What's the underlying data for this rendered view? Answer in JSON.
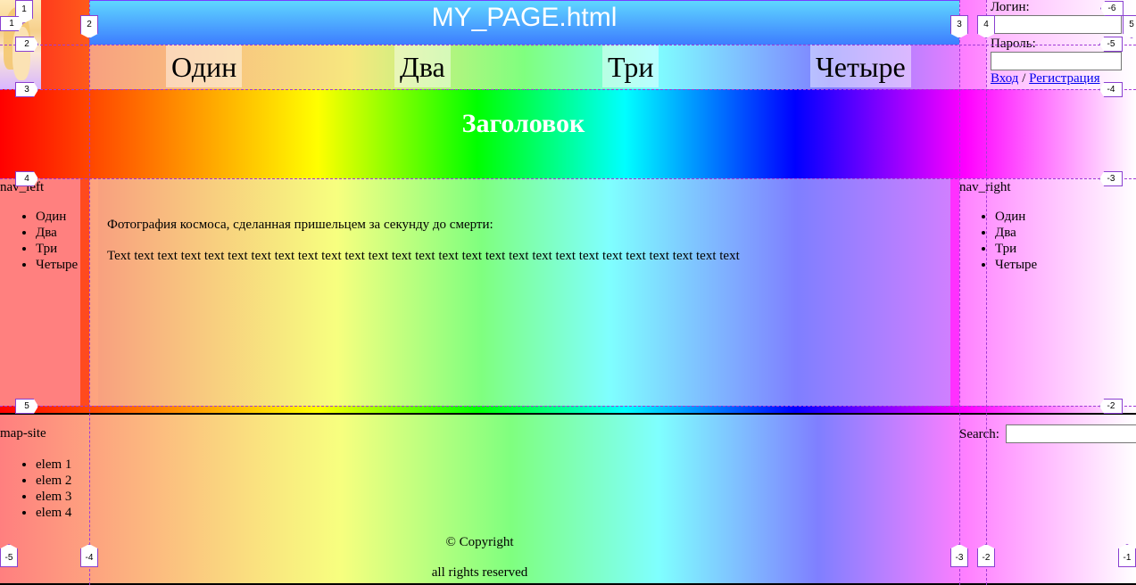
{
  "window": {
    "title": "MY_PAGE.html"
  },
  "nav": {
    "items": [
      "Один",
      "Два",
      "Три",
      "Четыре"
    ]
  },
  "login": {
    "login_label": "Логин:",
    "password_label": "Пароль:",
    "login_value": "",
    "password_value": "",
    "signin_link": "Вход",
    "separator": "/",
    "register_link": "Регистрация"
  },
  "header": {
    "title": "Заголовок"
  },
  "nav_left": {
    "title": "nav_left",
    "items": [
      "Один",
      "Два",
      "Три",
      "Четыре"
    ]
  },
  "nav_right": {
    "title": "nav_right",
    "items": [
      "Один",
      "Два",
      "Три",
      "Четыре"
    ]
  },
  "content": {
    "caption": "Фотография космоса, сделанная пришельцем за секунду до смерти:",
    "text": "Text text text text text text text text text text text text text text text text text text text text text text text text text text text"
  },
  "footer": {
    "map_title": "map-site",
    "map_items": [
      "elem 1",
      "elem 2",
      "elem 3",
      "elem 4"
    ],
    "copyright": "© Copyright",
    "rights": "all rights reserved",
    "search_label": "Search:",
    "search_value": ""
  },
  "guides": {
    "markers": [
      "1",
      "2",
      "3",
      "4",
      "5",
      "-6",
      "-5",
      "-4",
      "-3",
      "-2",
      "-1"
    ]
  },
  "colors": {
    "guide": "#a23bd6",
    "title_bar_top": "#5fd6ff",
    "title_bar_bottom": "#3d7dff",
    "link": "#0000ee"
  }
}
